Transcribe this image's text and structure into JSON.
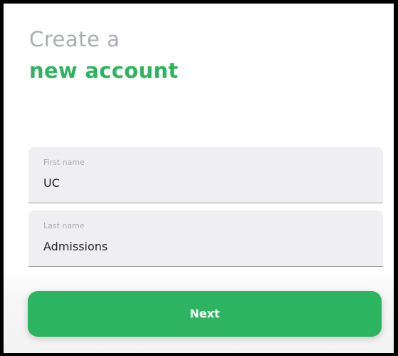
{
  "header": {
    "title_line1": "Create a",
    "title_line2": "new account"
  },
  "form": {
    "first_name": {
      "label": "First name",
      "value": "UC"
    },
    "last_name": {
      "label": "Last name",
      "value": "Admissions"
    }
  },
  "actions": {
    "next_label": "Next"
  },
  "colors": {
    "accent": "#2eb35f",
    "title_gray": "#a9adb3",
    "field_background": "#efeff1",
    "button_background": "#2db461"
  }
}
